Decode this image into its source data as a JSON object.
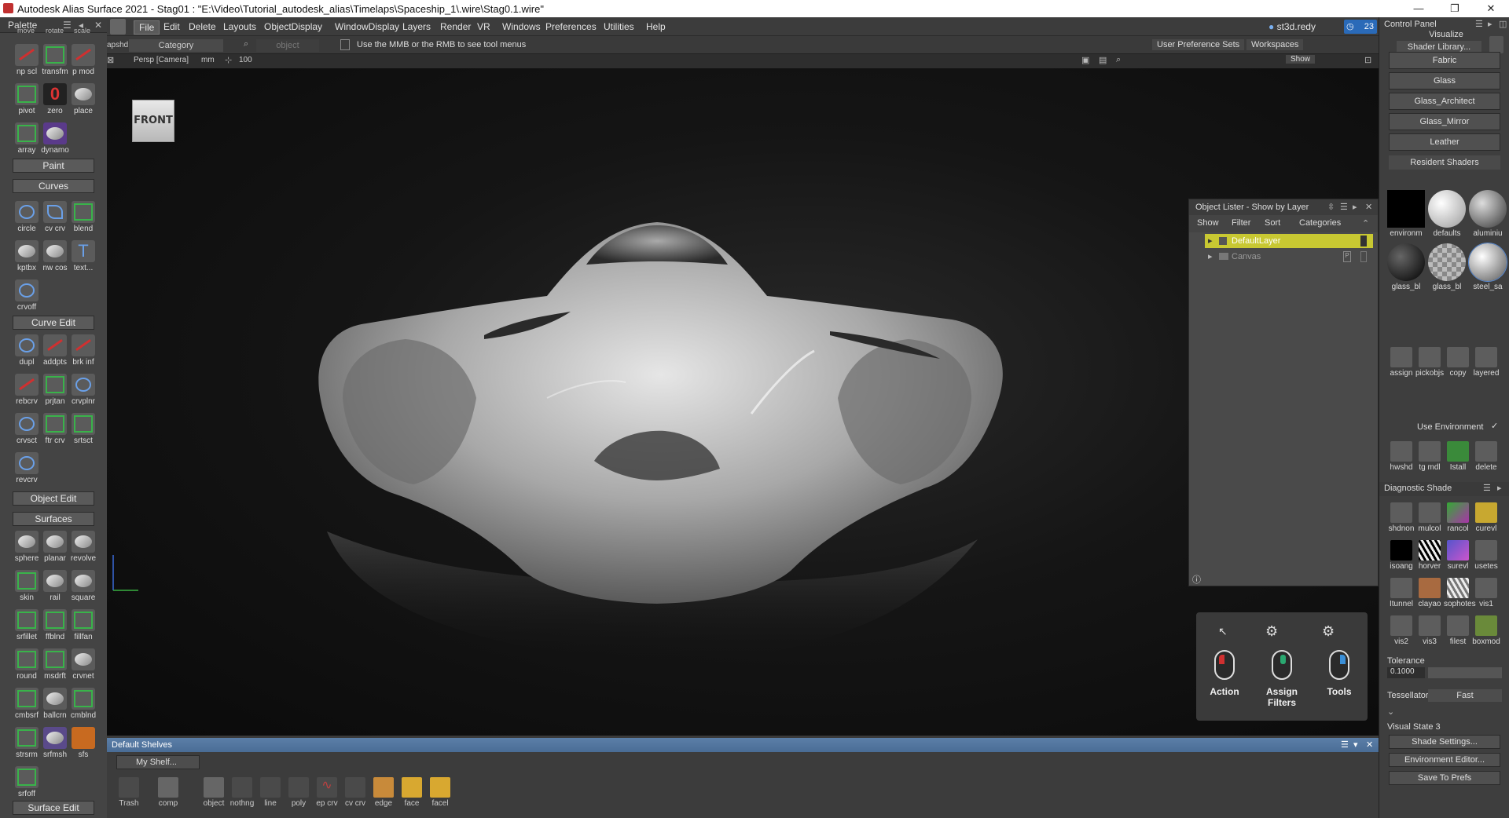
{
  "window": {
    "title": "Autodesk Alias Surface 2021 - Stag01 : \"E:\\Video\\Tutorial_autodesk_alias\\Timelaps\\Spaceship_1\\.wire\\Stag0.1.wire\"",
    "min": "—",
    "max": "❐",
    "close": "✕"
  },
  "palette": {
    "title": "Palette",
    "top_labels": [
      "move",
      "rotate",
      "scale"
    ],
    "row1": [
      "np scl",
      "transfm",
      "p mod"
    ],
    "row2": [
      "pivot",
      "zero",
      "place"
    ],
    "row3": [
      "array",
      "dynamo"
    ],
    "sections": {
      "paint": "Paint",
      "curves": "Curves",
      "curve_edit": "Curve Edit",
      "object_edit": "Object Edit",
      "surfaces": "Surfaces",
      "surface_edit": "Surface Edit"
    },
    "curves": [
      "circle",
      "cv crv",
      "blend",
      "kptbx",
      "nw cos",
      "text...",
      "crvoff"
    ],
    "curve_edit": [
      "dupl",
      "addpts",
      "brk inf",
      "rebcrv",
      "prjtan",
      "crvplnr",
      "crvsct",
      "ftr crv",
      "srtsct",
      "revcrv"
    ],
    "surfaces": [
      "sphere",
      "planar",
      "revolve",
      "skin",
      "rail",
      "square",
      "srfillet",
      "ffblnd",
      "fillfan",
      "round",
      "msdrft",
      "crvnet",
      "cmbsrf",
      "ballcrn",
      "cmblnd",
      "strsrm",
      "srfmsh",
      "sfs",
      "srfoff"
    ]
  },
  "menu": {
    "items": [
      "File",
      "Edit",
      "Delete",
      "Layouts",
      "ObjectDisplay",
      "WindowDisplay",
      "Layers",
      "Render",
      "VR",
      "Windows",
      "Preferences",
      "Utilities",
      "Help"
    ],
    "user": "st3d.redy",
    "badge": "23"
  },
  "toolbar": {
    "left_label": "apshd",
    "category": "Category",
    "object": "object",
    "hint": "Use the MMB or the RMB to see tool menus",
    "user_pref": "User Preference Sets",
    "workspaces": "Workspaces"
  },
  "viewport": {
    "camera": "Persp [Camera]",
    "unit": "mm",
    "scale": "100",
    "show": "Show",
    "cube_label": "FRONT"
  },
  "lister": {
    "title": "Object Lister - Show by Layer",
    "menu": [
      "Show",
      "Filter",
      "Sort",
      "Categories"
    ],
    "rows": [
      "DefaultLayer",
      "Canvas"
    ]
  },
  "mouse_help": {
    "labels": [
      "Action",
      "Assign Filters",
      "Tools"
    ]
  },
  "shelves": {
    "title": "Default Shelves",
    "tab": "My Shelf...",
    "items": [
      "Trash",
      "comp",
      "object",
      "nothng",
      "line",
      "poly",
      "ep crv",
      "cv crv",
      "edge",
      "face",
      "facel"
    ]
  },
  "control_panel": {
    "title": "Control Panel",
    "visualize": "Visualize",
    "shader_library": "Shader Library...",
    "library_buttons": [
      "Fabric",
      "Glass",
      "Glass_Architect",
      "Glass_Mirror",
      "Leather"
    ],
    "resident_shaders": "Resident Shaders",
    "shaders": [
      "environm",
      "defaults",
      "aluminiu",
      "glass_bl",
      "glass_bl",
      "steel_sa"
    ],
    "shader_tools": [
      "assign",
      "pickobjs",
      "copy",
      "layered"
    ],
    "use_environment": "Use Environment",
    "tools2": [
      "hwshd",
      "tg mdl",
      "Istall",
      "delete"
    ],
    "diagnostic": "Diagnostic Shade",
    "diag_tools": [
      "shdnon",
      "mulcol",
      "rancol",
      "curevl",
      "isoang",
      "horver",
      "surevl",
      "usetes",
      "Itunnel",
      "clayao",
      "sophotes",
      "vis1",
      "vis2",
      "vis3",
      "filest",
      "boxmod"
    ],
    "tolerance_label": "Tolerance",
    "tolerance": "0.1000",
    "tessellator_label": "Tessellator",
    "tessellator": "Fast",
    "visual_state": "Visual State 3",
    "buttons": [
      "Shade Settings...",
      "Environment Editor...",
      "Save To Prefs"
    ]
  },
  "colors": {
    "highlight": "#c8c832",
    "shelf_title": "#5b7fa8",
    "action_red": "#d03030",
    "filters_green": "#2aa870",
    "tools_blue": "#3a8fd8"
  }
}
